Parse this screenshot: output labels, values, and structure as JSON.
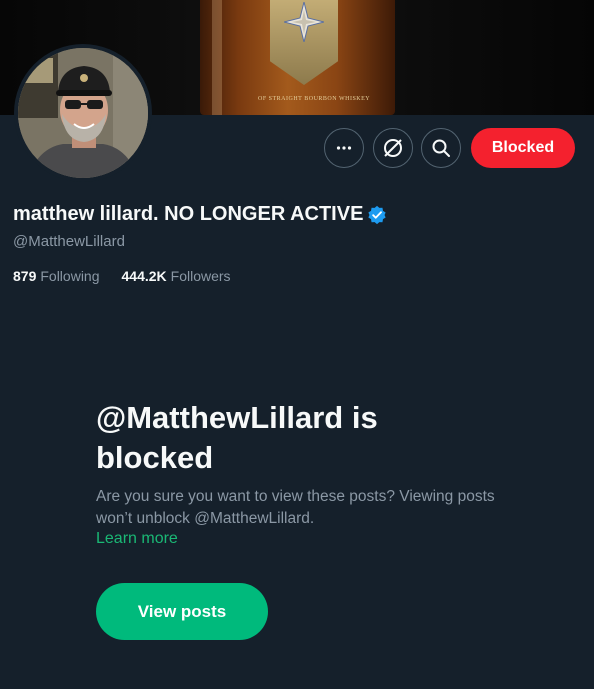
{
  "profile": {
    "display_name": "matthew lillard. NO LONGER ACTIVE",
    "handle": "@MatthewLillard",
    "following_count": "879",
    "following_label": "Following",
    "followers_count": "444.2K",
    "followers_label": "Followers",
    "banner_text": "OF STRAIGHT BOURBON WHISKEY"
  },
  "actions": {
    "more_icon": "more-dots-icon",
    "grok_icon": "grok-icon",
    "search_icon": "search-icon",
    "blocked_label": "Blocked"
  },
  "blocked_notice": {
    "title": "@MatthewLillard is blocked",
    "description": "Are you sure you want to view these posts? Viewing posts won’t unblock @MatthewLillard.",
    "learn_more": "Learn more",
    "view_posts_label": "View posts"
  },
  "colors": {
    "background": "#15202b",
    "blocked_red": "#f4212e",
    "accent_green": "#00ba7c",
    "verified_blue": "#1d9bf0",
    "secondary_text": "#8b98a5"
  }
}
